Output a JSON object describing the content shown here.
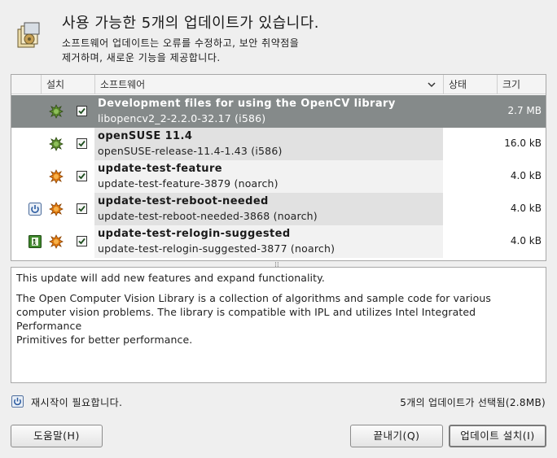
{
  "header": {
    "title": "사용 가능한 5개의 업데이트가 있습니다.",
    "subtitle_line1": "소프트웨어 업데이트는 오류를 수정하고, 보안 취약점을",
    "subtitle_line2": "제거하며, 새로운 기능을 제공합니다."
  },
  "columns": {
    "install": "설치",
    "software": "소프트웨어",
    "status": "상태",
    "size": "크기"
  },
  "updates": [
    {
      "name": "Development files for using the OpenCV library",
      "package": "libopencv2_2-2.2.0-32.17 (i586)",
      "size": "2.7 MB",
      "checked": true,
      "priority": "recommended-icon",
      "restart": ""
    },
    {
      "name": "openSUSE 11.4",
      "package": "openSUSE-release-11.4-1.43 (i586)",
      "size": "16.0 kB",
      "checked": true,
      "priority": "recommended-icon",
      "restart": ""
    },
    {
      "name": "update-test-feature",
      "package": "update-test-feature-3879 (noarch)",
      "size": "4.0 kB",
      "checked": true,
      "priority": "feature-icon",
      "restart": ""
    },
    {
      "name": "update-test-reboot-needed",
      "package": "update-test-reboot-needed-3868 (noarch)",
      "size": "4.0 kB",
      "checked": true,
      "priority": "feature-icon",
      "restart": "reboot-icon"
    },
    {
      "name": "update-test-relogin-suggested",
      "package": "update-test-relogin-suggested-3877 (noarch)",
      "size": "4.0 kB",
      "checked": true,
      "priority": "feature-icon",
      "restart": "relogin-icon"
    }
  ],
  "description": {
    "line1": "This update will add new features and expand functionality.",
    "line2": "The Open Computer Vision Library is a collection of algorithms and sample code for various",
    "line3": "computer vision problems. The library is compatible with IPL and utilizes Intel Integrated Performance",
    "line4": "Primitives for better performance."
  },
  "status": {
    "restart_required": "재시작이 필요합니다.",
    "selected_summary": "5개의 업데이트가 선택됨(2.8MB)"
  },
  "buttons": {
    "help": "도움말(H)",
    "close": "끝내기(Q)",
    "install": "업데이트 설치(I)"
  },
  "colors": {
    "selected_row": "#858a8a",
    "recommended": "#5c8a2e",
    "feature": "#e07a10"
  }
}
